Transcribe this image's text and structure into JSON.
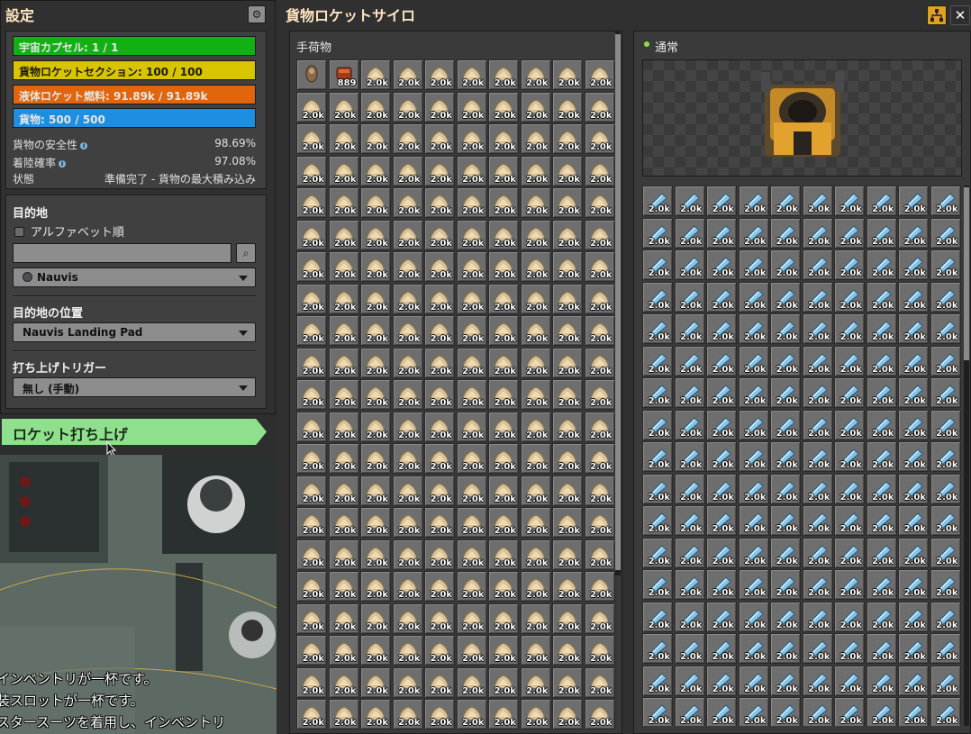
{
  "settings_panel": {
    "title": "設定",
    "bars": [
      {
        "label": "宇宙カプセル: 1 / 1",
        "color": "#13b013"
      },
      {
        "label": "貨物ロケットセクション: 100 / 100",
        "color": "#d8c400"
      },
      {
        "label": "液体ロケット燃料: 91.89k / 91.89k",
        "color": "#e0650c"
      },
      {
        "label": "貨物: 500 / 500",
        "color": "#1e8fe0"
      }
    ],
    "stats": [
      {
        "label": "貨物の安全性",
        "value": "98.69%"
      },
      {
        "label": "着陸確率",
        "value": "97.08%"
      },
      {
        "label": "状態",
        "value": "準備完了 - 貨物の最大積み込み"
      }
    ],
    "destination_label": "目的地",
    "alphabetical_label": "アルファベット順",
    "planet_select": "Nauvis",
    "destination_position_label": "目的地の位置",
    "landing_pad_select": "Nauvis Landing Pad",
    "launch_trigger_label": "打ち上げトリガー",
    "launch_trigger_select": "無し (手動)"
  },
  "launch_button_label": "ロケット打ち上げ",
  "console_lines": [
    "インベントリが一杯です。",
    "装スロットが一杯です。",
    "スタースーツを着用し、インベントリ"
  ],
  "silo_window": {
    "title": "貨物ロケットサイロ",
    "inventory_title": "手荷物",
    "output_title": "通常",
    "first_slots": [
      {
        "item": "space-capsule",
        "count": ""
      },
      {
        "item": "rocket-part",
        "count": "889"
      }
    ],
    "stack_count": "2.0k",
    "inventory_rows": 21,
    "output_rows": 17,
    "columns": 10
  },
  "colors": {
    "title_text": "#ffe6c0",
    "launch_green": "#8fe08c",
    "panel_bg": "#313031"
  }
}
